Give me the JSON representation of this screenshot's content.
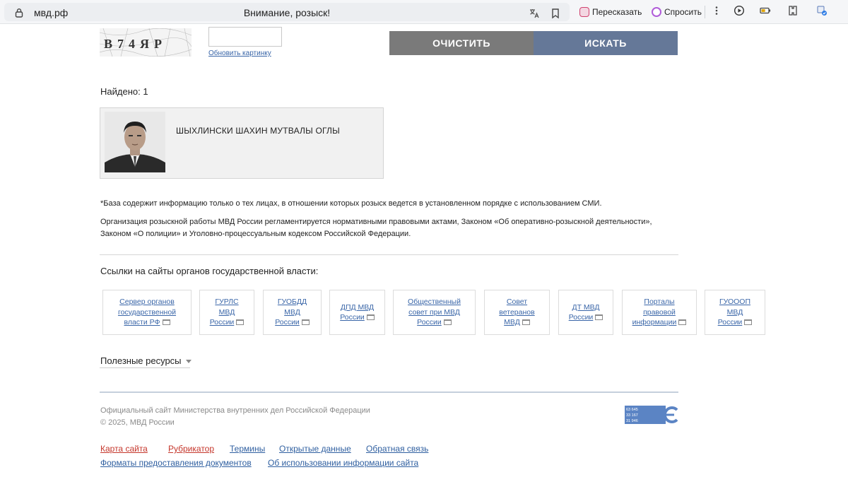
{
  "browser": {
    "url": "мвд.рф",
    "tab_title": "Внимание, розыск!",
    "retell_label": "Пересказать",
    "ask_label": "Спросить"
  },
  "captcha": {
    "text": "В74ЯР",
    "refresh_link": "Обновить картинку",
    "input_value": ""
  },
  "buttons": {
    "clear": "очистить",
    "search": "искать"
  },
  "results": {
    "found_label": "Найдено: 1",
    "person_name": "ШЫХЛИНСКИ ШАХИН МУТВАЛЫ ОГЛЫ"
  },
  "notes": {
    "disclaimer": "*База содержит информацию только о тех лицах, в отношении которых розыск ведется в установленном порядке с использованием СМИ.",
    "legal_line1": "Организация розыскной работы МВД России регламентируется нормативными правовыми актами, Законом «Об оперативно-розыскной деятельности»,",
    "legal_line2": "Законом «О полиции» и Уголовно-процессуальным кодексом Российской Федерации."
  },
  "gov_links": {
    "title": "Ссылки на сайты органов государственной власти:",
    "items": [
      {
        "l1": "Сервер органов",
        "l2": "государственной",
        "l3": "власти РФ"
      },
      {
        "l1": "ГУРЛС",
        "l2": "МВД",
        "l3": "России"
      },
      {
        "l1": "ГУОБДД",
        "l2": "МВД",
        "l3": "России"
      },
      {
        "l1": "ДПД МВД",
        "l2": "России",
        "l3": ""
      },
      {
        "l1": "Общественный",
        "l2": "совет при МВД",
        "l3": "России"
      },
      {
        "l1": "Совет",
        "l2": "ветеранов",
        "l3": "МВД"
      },
      {
        "l1": "ДТ МВД",
        "l2": "России",
        "l3": ""
      },
      {
        "l1": "Порталы",
        "l2": "правовой",
        "l3": "информации"
      },
      {
        "l1": "ГУОООП",
        "l2": "МВД",
        "l3": "России"
      }
    ]
  },
  "useful_resources": "Полезные ресурсы",
  "footer": {
    "official": "Официальный сайт Министерства внутренних дел Российской Федерации",
    "copyright": "© 2025, МВД России",
    "counter": [
      "63 645",
      "33 167",
      "31 946"
    ],
    "links": {
      "sitemap": "Карта сайта",
      "rubricator": "Рубрикатор",
      "terms": "Термины",
      "open_data": "Открытые данные",
      "feedback": "Обратная связь",
      "formats": "Форматы предоставления документов",
      "usage": "Об использовании информации сайта"
    }
  },
  "colors": {
    "clear_button": "#7a7a7a",
    "search_button": "#657898",
    "link_blue": "#2f5fa0",
    "link_red": "#c5362b"
  }
}
